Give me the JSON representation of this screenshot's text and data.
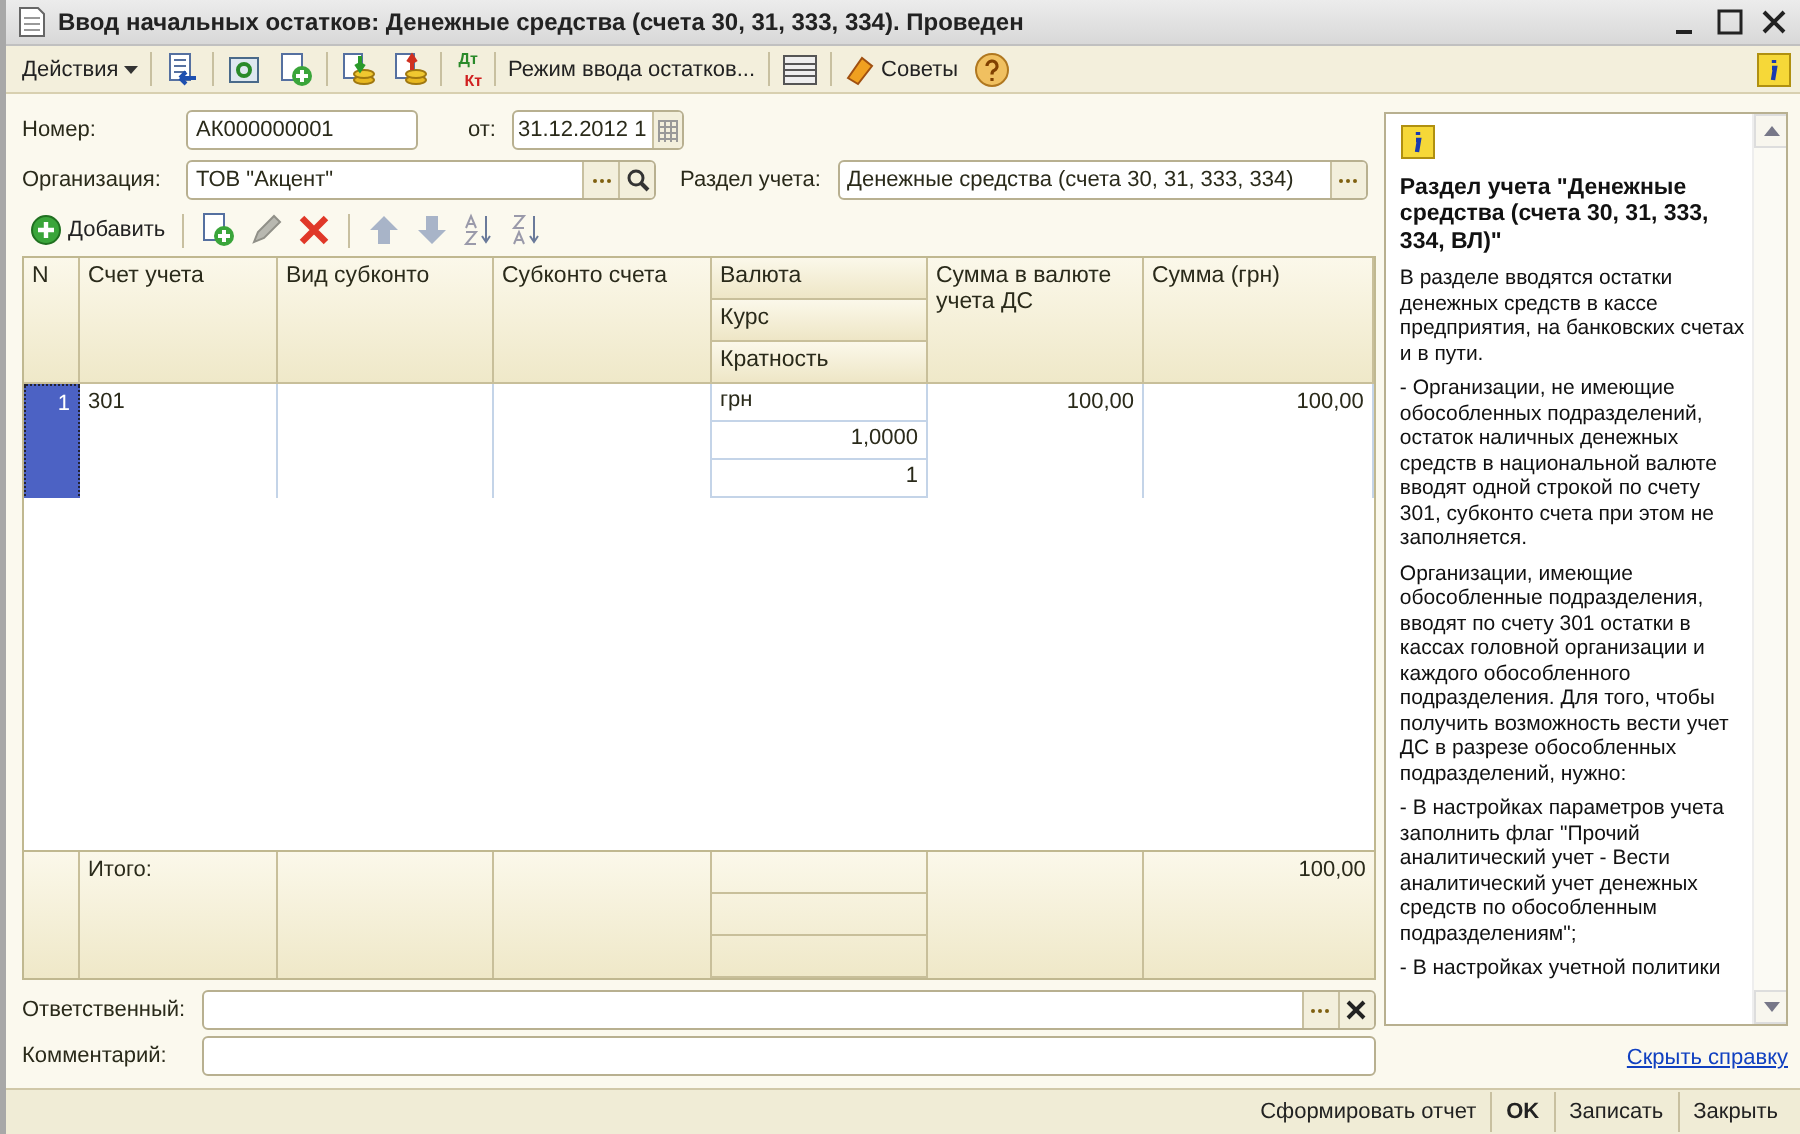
{
  "window": {
    "title": "Ввод начальных остатков: Денежные средства (счета 30, 31, 333, 334). Проведен"
  },
  "toolbar": {
    "actions_menu": "Действия",
    "debit_label": "Дт",
    "credit_label": "Кт",
    "mode_button": "Режим ввода остатков...",
    "tips_button": "Советы"
  },
  "form": {
    "number_label": "Номер:",
    "number_value": "АК000000001",
    "date_label": "от:",
    "date_value": "31.12.2012 1",
    "org_label": "Организация:",
    "org_value": "ТОВ \"Акцент\"",
    "section_label": "Раздел учета:",
    "section_value": "Денежные средства (счета 30, 31, 333, 334)"
  },
  "table_toolbar": {
    "add_label": "Добавить"
  },
  "table": {
    "columns": [
      {
        "kind": "single",
        "label": "N"
      },
      {
        "kind": "single",
        "label": "Счет учета"
      },
      {
        "kind": "single",
        "label": "Вид субконто"
      },
      {
        "kind": "single",
        "label": "Субконто счета"
      },
      {
        "kind": "stacked",
        "labels": [
          "Валюта",
          "Курс",
          "Кратность"
        ]
      },
      {
        "kind": "single",
        "label": "Сумма в валюте учета ДС"
      },
      {
        "kind": "single",
        "label": "Сумма (грн)"
      }
    ],
    "rows": [
      {
        "n": "1",
        "account": "301",
        "currency": "грн",
        "rate": "1,0000",
        "multiplicity": "1",
        "sum_currency": "100,00",
        "sum_uah": "100,00",
        "selected": true
      }
    ],
    "totals": {
      "label": "Итого:",
      "sum_uah": "100,00"
    }
  },
  "responsible_label": "Ответственный:",
  "comment_label": "Комментарий:",
  "help": {
    "title": "Раздел учета \"Денежные средства (счета 30, 31, 333, 334, ВЛ)\"",
    "paragraphs": [
      "В разделе вводятся остатки денежных средств в кассе предприятия, на банковских счетах и в пути.",
      "- Организации, не имеющие обособленных подразделений, остаток наличных денежных средств в национальной валюте вводят одной строкой по счету 301, субконто счета при этом не заполняется.",
      "Организации, имеющие обособленные подразделения, вводят по счету 301 остатки в кассах головной организации и каждого обособленного подразделения. Для того, чтобы получить возможность вести учет ДС в разрезе обособленных подразделений, нужно:",
      "- В настройках параметров учета заполнить флаг \"Прочий аналитический учет - Вести аналитический учет денежных средств по обособленным подразделениям\";",
      "- В настройках учетной политики"
    ],
    "hide_link": "Скрыть справку"
  },
  "buttons": [
    {
      "label": "Сформировать отчет",
      "kind": "normal"
    },
    {
      "label": "OK",
      "kind": "default"
    },
    {
      "label": "Записать",
      "kind": "normal"
    },
    {
      "label": "Закрыть",
      "kind": "normal"
    }
  ]
}
